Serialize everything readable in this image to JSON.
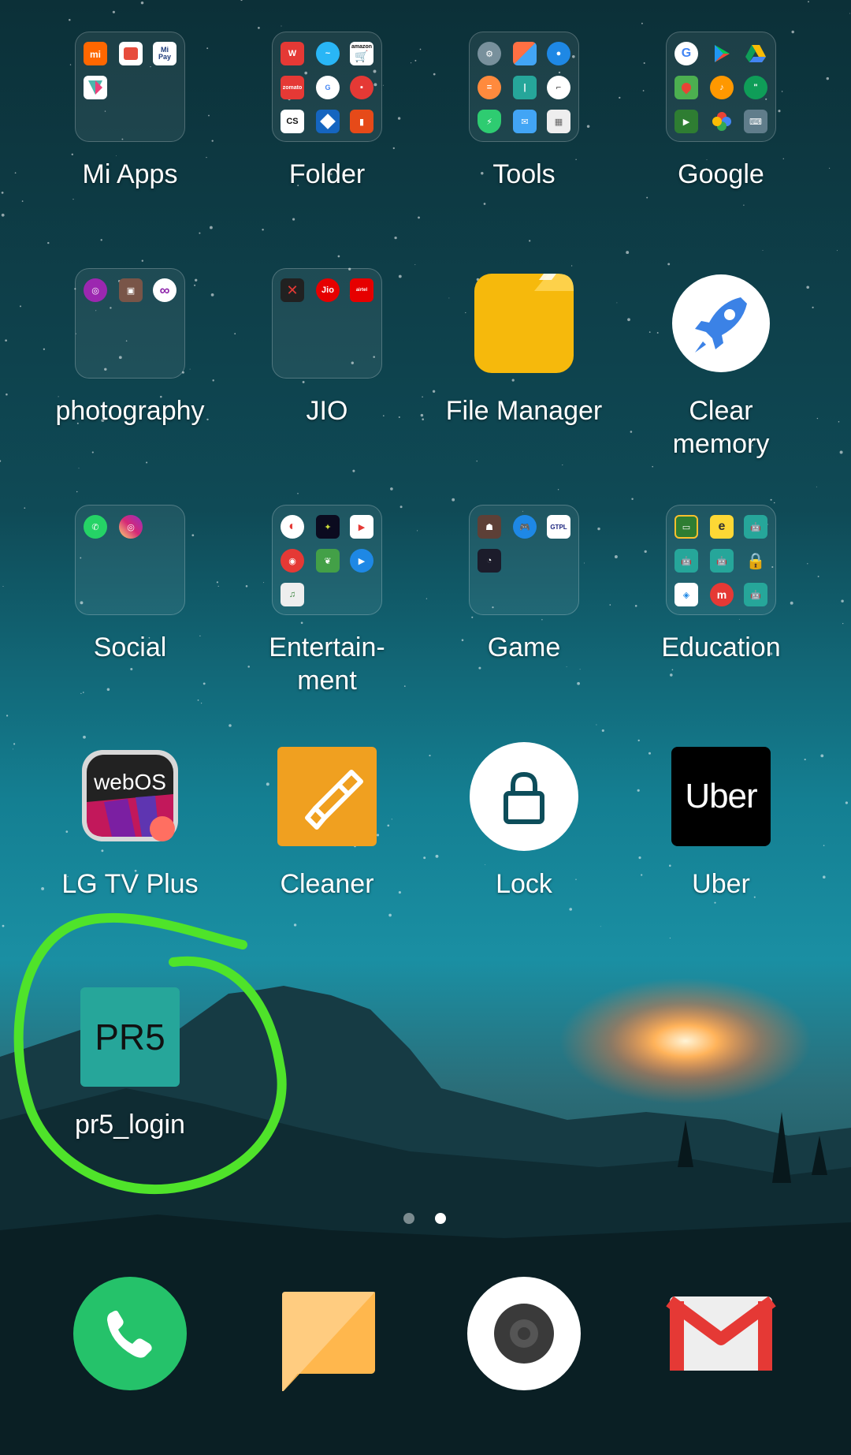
{
  "apps": {
    "mi_apps": {
      "label": "Mi Apps",
      "type": "folder",
      "icons": [
        "mi-icon",
        "mi-store-icon",
        "mi-pay-icon",
        "mi-download-icon"
      ],
      "mi_pay_text": "Mi\nPay"
    },
    "folder": {
      "label": "Folder",
      "type": "folder",
      "icons": [
        "wps-icon",
        "swiftkey-icon",
        "amazon-icon",
        "zomato-icon",
        "gpay-icon",
        "ecommerce-icon",
        "cs-icon",
        "dominos-icon",
        "orange-app-icon"
      ],
      "zomato_text": "zomato",
      "amazon_text": "amazon",
      "cs_text": "CS"
    },
    "tools": {
      "label": "Tools",
      "type": "folder",
      "icons": [
        "settings-icon",
        "gallery-icon",
        "contacts-icon",
        "calculator-icon",
        "notes-icon",
        "clock-icon",
        "security-icon",
        "email-icon",
        "calendar-icon"
      ]
    },
    "google": {
      "label": "Google",
      "type": "folder",
      "icons": [
        "google-icon",
        "play-store-icon",
        "drive-icon",
        "maps-icon",
        "play-music-icon",
        "hangouts-icon",
        "play-games-icon",
        "photos-icon",
        "gboard-icon"
      ]
    },
    "photography": {
      "label": "photography",
      "type": "folder",
      "icons": [
        "photo-editor-icon",
        "photo-app-icon",
        "infinity-icon"
      ]
    },
    "jio": {
      "label": "JIO",
      "type": "folder",
      "icons": [
        "jio-x-icon",
        "jio-icon",
        "airtel-icon"
      ],
      "jio_text": "Jio",
      "airtel_text": "airtel"
    },
    "file_manager": {
      "label": "File Manager",
      "type": "app",
      "icon": "folder-icon"
    },
    "clear_memory": {
      "label": "Clear\nmemory",
      "type": "app",
      "icon": "rocket-icon"
    },
    "social": {
      "label": "Social",
      "type": "folder",
      "icons": [
        "whatsapp-icon",
        "instagram-icon"
      ]
    },
    "entertainment": {
      "label": "Entertain-\nment",
      "type": "folder",
      "icons": [
        "music-icon",
        "hotstar-icon",
        "play-movies-icon",
        "gaana-icon",
        "game-app-icon",
        "video-player-icon",
        "saavn-icon"
      ]
    },
    "game": {
      "label": "Game",
      "type": "folder",
      "icons": [
        "pubg-icon",
        "game-controller-icon",
        "gtpl-icon",
        "speedometer-icon"
      ],
      "gtpl_text": "GTPL"
    },
    "education": {
      "label": "Education",
      "type": "folder",
      "icons": [
        "classroom-icon",
        "e-icon",
        "android-icon",
        "android-icon",
        "android-icon",
        "lock-app-icon",
        "edu-app-icon",
        "m-app-icon",
        "android-icon"
      ],
      "e_text": "e",
      "m_text": "m"
    },
    "lg_tv_plus": {
      "label": "LG TV Plus",
      "type": "app",
      "icon": "webos-icon",
      "icon_text": "webOS"
    },
    "cleaner": {
      "label": "Cleaner",
      "type": "app",
      "icon": "brush-icon"
    },
    "lock": {
      "label": "Lock",
      "type": "app",
      "icon": "lock-icon"
    },
    "uber": {
      "label": "Uber",
      "type": "app",
      "icon": "uber-icon",
      "icon_text": "Uber"
    },
    "pr5_login": {
      "label": "pr5_login",
      "type": "app",
      "icon": "pr5-icon",
      "icon_text": "PR5"
    }
  },
  "page_indicator": {
    "pages": 2,
    "active": 2
  },
  "dock": [
    {
      "name": "phone",
      "icon": "phone-icon"
    },
    {
      "name": "messages",
      "icon": "message-icon"
    },
    {
      "name": "camera",
      "icon": "camera-icon"
    },
    {
      "name": "gmail",
      "icon": "gmail-icon"
    }
  ],
  "colors": {
    "highlight_circle": "#4fe32a",
    "phone_green": "#25c26a",
    "folder_yellow": "#f6b90c",
    "pr5_teal": "#26a69a",
    "cleaner_orange": "#f0a020"
  }
}
